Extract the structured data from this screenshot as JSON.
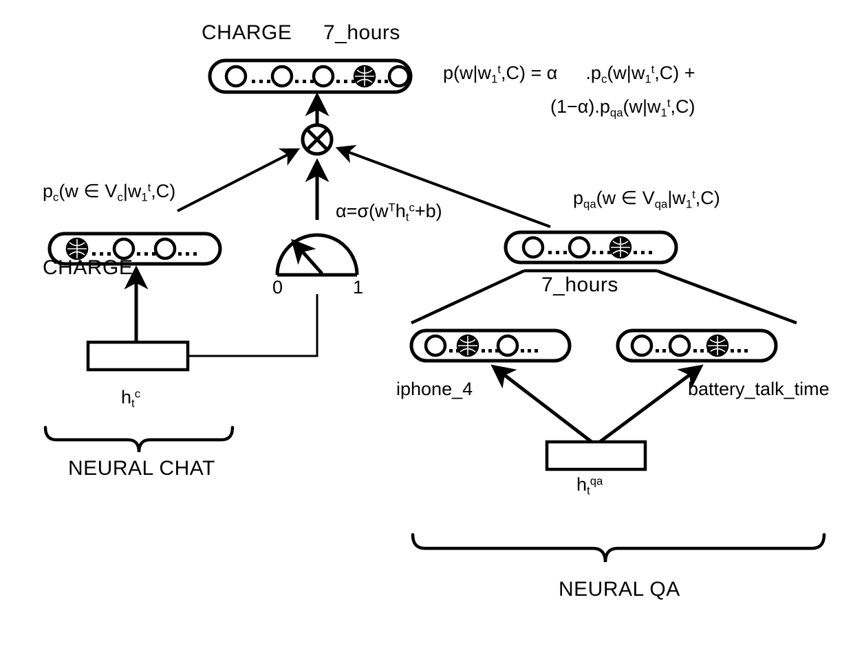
{
  "figure": {
    "type": "neural-network-architecture-diagram",
    "background_color": "#ffffff",
    "stroke_color": "#000000"
  },
  "labels": {
    "top_left_word": "CHARGE",
    "top_right_word": "7_hours",
    "chat_vector_word": "CHARGE",
    "qa_vector_word": "7_hours",
    "qa_left_word": "iphone_4",
    "qa_right_word": "battery_talk_time",
    "gauge_min": "0",
    "gauge_max": "1",
    "brace_left_label": "NEURAL CHAT",
    "brace_right_label": "NEURAL QA"
  },
  "formulas": {
    "mixture_line1_lhs": "p(w|w",
    "mixture_line1": "p(w|w₁ᵗ,C) = α",
    "mixture_line1_tail": ".p_c(w|w₁ᵗ,C) +",
    "mixture_line2": "(1−α).p_qa(w|w₁ᵗ,C)",
    "alpha_gate": "α=σ(wᵀh_tᶜ+b)",
    "chat_prob": "p_c(w ∈ V_c|w₁ᵗ,C)",
    "qa_prob": "p_qa(w ∈ V_qa|w₁ᵗ,C)",
    "hidden_chat": "h_tᶜ",
    "hidden_qa": "h_tqa"
  },
  "vectors": {
    "output": {
      "name": "output-distribution-vector",
      "cells": [
        "open",
        "open",
        "open",
        "filled",
        "open"
      ]
    },
    "chat": {
      "name": "chat-distribution-vector",
      "cells": [
        "filled",
        "open",
        "open"
      ]
    },
    "qa": {
      "name": "qa-distribution-vector",
      "cells": [
        "open",
        "open",
        "filled"
      ]
    },
    "qa_left": {
      "name": "qa-entity-vector",
      "cells": [
        "open",
        "filled",
        "open"
      ]
    },
    "qa_right": {
      "name": "qa-relation-vector",
      "cells": [
        "open",
        "open",
        "filled"
      ]
    }
  },
  "nodes": {
    "multiply_symbol": "⊗",
    "chat_rnn_box": "",
    "qa_kb_box": ""
  }
}
